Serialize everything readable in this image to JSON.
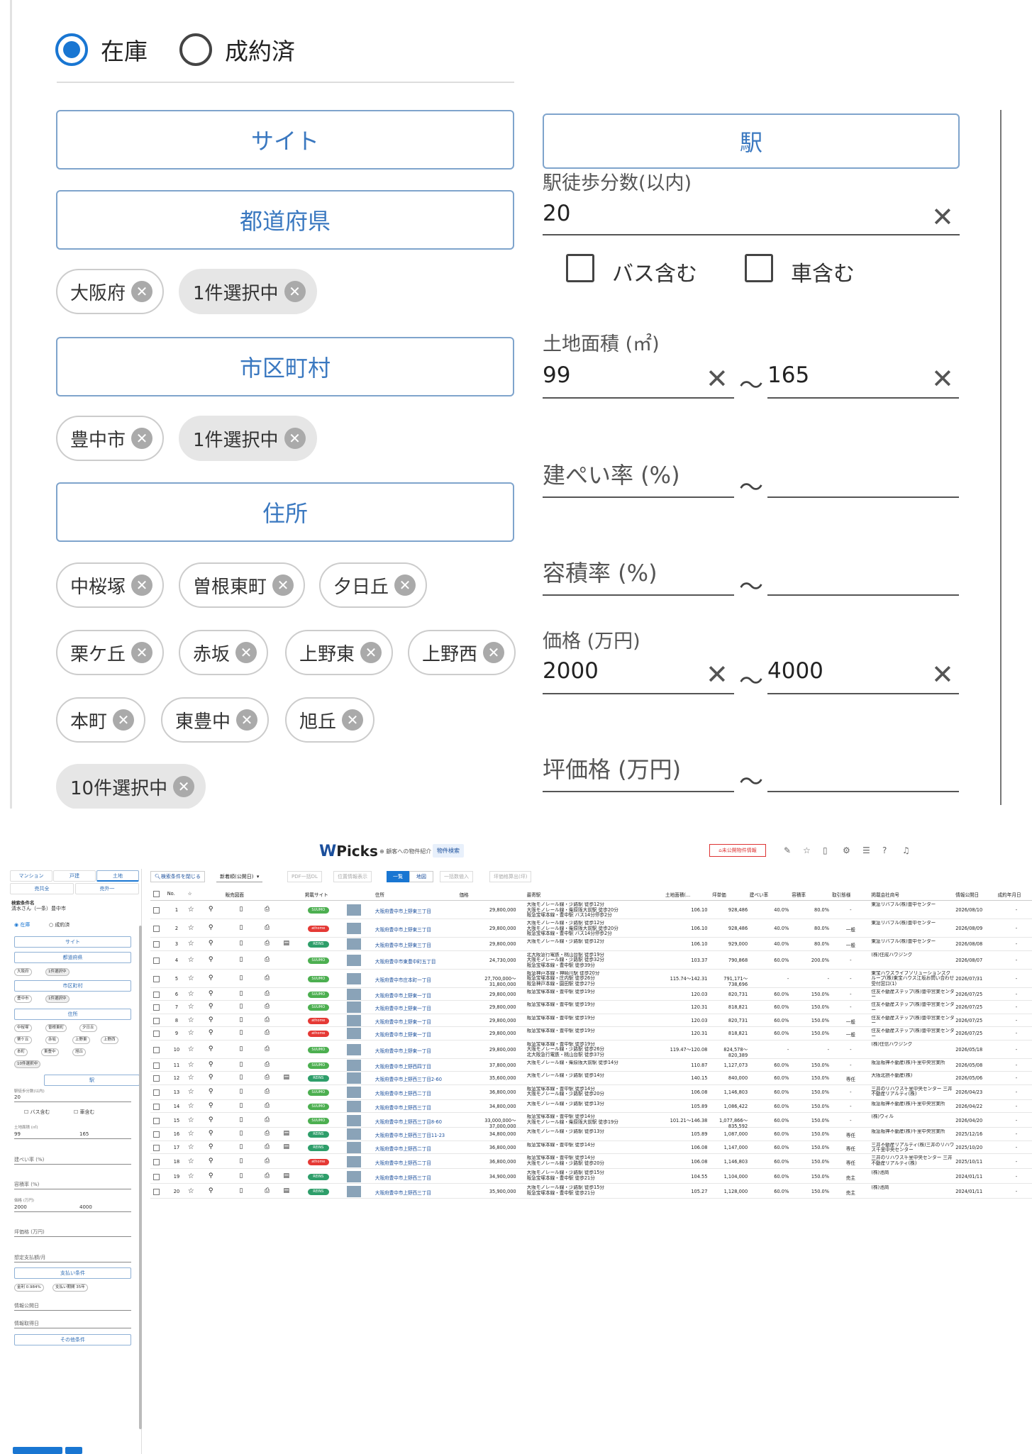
{
  "zoom": {
    "radio": {
      "stock": "在庫",
      "sold": "成約済"
    },
    "buttons": {
      "site": "サイト",
      "prefecture": "都道府県",
      "city": "市区町村",
      "address": "住所",
      "station": "駅"
    },
    "pref_chips": [
      "大阪府",
      "1件選択中"
    ],
    "city_chips": [
      "豊中市",
      "1件選択中"
    ],
    "address_chips": [
      "中桜塚",
      "曽根東町",
      "夕日丘",
      "栗ケ丘",
      "赤坂",
      "上野東",
      "上野西",
      "本町",
      "東豊中",
      "旭丘",
      "10件選択中"
    ],
    "walk": {
      "label": "駅徒歩分数(以内)",
      "value": "20"
    },
    "checks": {
      "bus": "バス含む",
      "car": "車含む"
    },
    "land": {
      "label": "土地面積 (㎡)",
      "min": "99",
      "max": "165"
    },
    "coverage": {
      "label": "建ぺい率 (%)"
    },
    "far": {
      "label": "容積率 (%)"
    },
    "price": {
      "label": "価格 (万円)",
      "min": "2000",
      "max": "4000"
    },
    "tsubo": {
      "label": "坪価格 (万円)"
    },
    "clear_glyph": "✕",
    "tilde": "～"
  },
  "app": {
    "logo_prefix": "W",
    "logo": "Picks",
    "nav_intro": "顧客への物件紹介",
    "nav_search": "物件検索",
    "unpublished_btn": "未公開物件情報",
    "sidebar": {
      "tabs": [
        "マンション",
        "戸建",
        "土地"
      ],
      "subtabs": [
        "売共全",
        "売外一"
      ],
      "cond_label": "検索条件名",
      "cond_value": "清水さん（一条）豊中市",
      "radio_stock": "在庫",
      "radio_sold": "成約済",
      "site": "サイト",
      "pref": "都道府県",
      "pref_chips": [
        "大阪府",
        "1件選択中"
      ],
      "city": "市区町村",
      "city_chips": [
        "豊中市",
        "1件選択中"
      ],
      "addr": "住所",
      "addr_chips_r1": [
        "中桜塚",
        "曽根東町",
        "夕日丘"
      ],
      "addr_chips_r2": [
        "栗ケ丘",
        "赤坂",
        "上野東",
        "上野西"
      ],
      "addr_chips_r3": [
        "本町",
        "東豊中",
        "旭丘"
      ],
      "addr_sel": "10件選択中",
      "station": "駅",
      "walk_label": "駅徒歩分数(以内)",
      "walk": "20",
      "bus": "バス含む",
      "car": "車含む",
      "land_label": "土地面積 (㎡)",
      "land_min": "99",
      "land_max": "165",
      "coverage": "建ぺい率 (%)",
      "far": "容積率 (%)",
      "price_label": "価格 (万円)",
      "price_min": "2000",
      "price_max": "4000",
      "tsubo": "坪価格 (万円)",
      "monthly": "想定支払額/月",
      "payment": "支払い条件",
      "pay_chips": [
        "金利 0.984%",
        "支払い期間 35年"
      ],
      "pub_date": "情報公開日",
      "get_date": "情報取得日",
      "other": "その他条件"
    },
    "toolbar": {
      "close_search": "検索条件を閉じる",
      "sort": "新着順(公開日)",
      "pdf": "PDF一括DL",
      "map_show": "位置情報表示",
      "list": "一覧",
      "map": "地図",
      "bulk": "一括数値入",
      "tsubo_calc": "坪価格算出(坪)"
    },
    "headers": [
      "No.",
      "☆",
      "",
      "販売図面",
      "",
      "",
      "掲載サイト",
      "",
      "住所",
      "価格",
      "最寄駅",
      "土地面積(...",
      "坪単価",
      "建ぺい率",
      "容積率",
      "取引態様",
      "掲載会社商号",
      "情報公開日",
      "成約年月日"
    ],
    "rows": [
      {
        "no": "1",
        "site": "SUUMO",
        "addr": "大阪府豊中市上野東三丁目",
        "price": "29,800,000",
        "station": "大阪モノレール線・少路駅 徒歩12分 / 大阪モノレール線・柴原阪大前駅 徒歩20分 / 阪急宝塚本線・豊中駅 バス14分停歩2分",
        "area": "106.10",
        "tsubo": "928,486",
        "cov": "40.0%",
        "far": "80.0%",
        "deal": "-",
        "company": "東急リバブル(株)豊中センター",
        "pub": "2026/08/10",
        "sold": "-"
      },
      {
        "no": "2",
        "site": "athome",
        "addr": "大阪府豊中市上野東三丁目",
        "price": "29,800,000",
        "station": "大阪モノレール線・少路駅 徒歩12分 / 大阪モノレール線・柴原阪大前駅 徒歩20分 / 阪急宝塚本線・豊中駅 バス14分停歩2分",
        "area": "106.10",
        "tsubo": "928,486",
        "cov": "40.0%",
        "far": "80.0%",
        "deal": "一般",
        "company": "東急リバブル(株)豊中センター",
        "pub": "2026/08/09",
        "sold": "-"
      },
      {
        "no": "3",
        "site": "REINS",
        "addr": "大阪府豊中市上野東三丁目",
        "price": "29,800,000",
        "station": "大阪モノレール線・少路駅 徒歩12分",
        "area": "106.10",
        "tsubo": "929,000",
        "cov": "40.0%",
        "far": "80.0%",
        "deal": "一般",
        "company": "東急リバブル(株)豊中センター",
        "pub": "2026/08/08",
        "sold": "-"
      },
      {
        "no": "4",
        "site": "SUUMO",
        "addr": "大阪府豊中市東豊中町五丁目",
        "price": "24,730,000",
        "station": "北大阪急行電鉄・桃山台駅 徒歩19分 / 大阪モノレール線・少路駅 徒歩32分 / 阪急宝塚本線・豊中駅 徒歩39分",
        "area": "103.37",
        "tsubo": "790,868",
        "cov": "60.0%",
        "far": "200.0%",
        "deal": "-",
        "company": "(株)住成ハウジング",
        "pub": "2026/08/07",
        "sold": "-"
      },
      {
        "no": "5",
        "site": "SUUMO",
        "addr": "大阪府豊中市庄本町一丁目",
        "price": "27,700,000～31,800,000",
        "station": "阪急神戸本線・神崎川駅 徒歩20分 / 阪急宝塚本線・庄内駅 徒歩26分 / 阪急神戸本線・園田駅 徒歩27分",
        "area": "115.74～142.31",
        "tsubo": "791,171～738,696",
        "cov": "-",
        "far": "-",
        "deal": "-",
        "company": "東宝ハウスライフソリューションズグループ(株)東宝ハウス江坂お問い合わせ受付窓口(1)",
        "pub": "2026/07/31",
        "sold": "-"
      },
      {
        "no": "6",
        "site": "SUUMO",
        "addr": "大阪府豊中市上野東一丁目",
        "price": "29,800,000",
        "station": "阪急宝塚本線・豊中駅 徒歩19分",
        "area": "120.03",
        "tsubo": "820,731",
        "cov": "60.0%",
        "far": "150.0%",
        "deal": "-",
        "company": "住友不動産ステップ(株)豊中営業センター",
        "pub": "2026/07/25",
        "sold": "-"
      },
      {
        "no": "7",
        "site": "SUUMO",
        "addr": "大阪府豊中市上野東一丁目",
        "price": "29,800,000",
        "station": "阪急宝塚本線・豊中駅 徒歩19分",
        "area": "120.31",
        "tsubo": "818,821",
        "cov": "60.0%",
        "far": "150.0%",
        "deal": "-",
        "company": "住友不動産ステップ(株)豊中営業センター",
        "pub": "2026/07/25",
        "sold": "-"
      },
      {
        "no": "8",
        "site": "athome",
        "addr": "大阪府豊中市上野東一丁目",
        "price": "29,800,000",
        "station": "阪急宝塚本線・豊中駅 徒歩19分",
        "area": "120.03",
        "tsubo": "820,731",
        "cov": "60.0%",
        "far": "150.0%",
        "deal": "一般",
        "company": "住友不動産ステップ(株)豊中営業センター",
        "pub": "2026/07/25",
        "sold": "-"
      },
      {
        "no": "9",
        "site": "athome",
        "addr": "大阪府豊中市上野東一丁目",
        "price": "29,800,000",
        "station": "阪急宝塚本線・豊中駅 徒歩19分",
        "area": "120.31",
        "tsubo": "818,821",
        "cov": "60.0%",
        "far": "150.0%",
        "deal": "一般",
        "company": "住友不動産ステップ(株)豊中営業センター",
        "pub": "2026/07/25",
        "sold": "-"
      },
      {
        "no": "10",
        "site": "SUUMO",
        "addr": "大阪府豊中市上野東一丁目",
        "price": "29,800,000",
        "station": "阪急宝塚本線・豊中駅 徒歩19分 / 大阪モノレール線・少路駅 徒歩26分 / 北大阪急行電鉄・桃山台駅 徒歩37分",
        "area": "119.47～120.08",
        "tsubo": "824,578～820,389",
        "cov": "-",
        "far": "-",
        "deal": "-",
        "company": "(株)住信ハウジング",
        "pub": "2026/05/18",
        "sold": "-"
      },
      {
        "no": "11",
        "site": "SUUMO",
        "addr": "大阪府豊中市上野西四丁目",
        "price": "37,800,000",
        "station": "大阪モノレール線・柴原阪大前駅 徒歩14分",
        "area": "110.87",
        "tsubo": "1,127,073",
        "cov": "60.0%",
        "far": "150.0%",
        "deal": "-",
        "company": "阪急阪神不動産(株)千里中央営業所",
        "pub": "2026/05/08",
        "sold": "-"
      },
      {
        "no": "12",
        "site": "REINS",
        "addr": "大阪府豊中市上野西三丁目2-60",
        "price": "35,600,000",
        "station": "大阪モノレール線・少路駅 徒歩14分",
        "area": "140.15",
        "tsubo": "840,000",
        "cov": "60.0%",
        "far": "150.0%",
        "deal": "専任",
        "company": "大阪北摂不動産(株)",
        "pub": "2026/05/06",
        "sold": "-"
      },
      {
        "no": "13",
        "site": "SUUMO",
        "addr": "大阪府豊中市上野西二丁目",
        "price": "36,800,000",
        "station": "阪急宝塚本線・豊中駅 徒歩14分 / 大阪モノレール線・少路駅 徒歩20分",
        "area": "106.08",
        "tsubo": "1,146,803",
        "cov": "60.0%",
        "far": "150.0%",
        "deal": "-",
        "company": "三井のリハウス千里中央センター 三井不動産リアルティ(株)",
        "pub": "2026/04/23",
        "sold": "-"
      },
      {
        "no": "14",
        "site": "SUUMO",
        "addr": "大阪府豊中市上野西三丁目",
        "price": "34,800,000",
        "station": "大阪モノレール線・少路駅 徒歩13分",
        "area": "105.89",
        "tsubo": "1,086,422",
        "cov": "60.0%",
        "far": "150.0%",
        "deal": "-",
        "company": "阪急阪神不動産(株)千里中央営業所",
        "pub": "2026/04/22",
        "sold": "-"
      },
      {
        "no": "15",
        "site": "SUUMO",
        "addr": "大阪府豊中市上野西三丁目8-60",
        "price": "33,000,000～37,000,000",
        "station": "阪急宝塚本線・豊中駅 徒歩14分 / 大阪モノレール線・柴原阪大前駅 徒歩19分",
        "area": "101.21～146.38",
        "tsubo": "1,077,866～835,592",
        "cov": "60.0%",
        "far": "150.0%",
        "deal": "-",
        "company": "(株)ウィル",
        "pub": "2026/04/20",
        "sold": "-"
      },
      {
        "no": "16",
        "site": "REINS",
        "addr": "大阪府豊中市上野西三丁目11-23",
        "price": "34,800,000",
        "station": "大阪モノレール線・少路駅 徒歩13分",
        "area": "105.89",
        "tsubo": "1,087,000",
        "cov": "60.0%",
        "far": "150.0%",
        "deal": "専任",
        "company": "阪急阪神不動産(株)千里中央営業所",
        "pub": "2025/12/16",
        "sold": "-"
      },
      {
        "no": "17",
        "site": "REINS",
        "addr": "大阪府豊中市上野西二丁目",
        "price": "36,800,000",
        "station": "阪急宝塚本線・豊中駅 徒歩14分",
        "area": "106.08",
        "tsubo": "1,147,000",
        "cov": "60.0%",
        "far": "150.0%",
        "deal": "専任",
        "company": "三井不動産リアルティ(株)三井のリハウス千里中央センター",
        "pub": "2025/10/20",
        "sold": "-"
      },
      {
        "no": "18",
        "site": "athome",
        "addr": "大阪府豊中市上野西二丁目",
        "price": "36,800,000",
        "station": "阪急宝塚本線・豊中駅 徒歩14分 / 大阪モノレール線・少路駅 徒歩20分",
        "area": "106.08",
        "tsubo": "1,146,803",
        "cov": "60.0%",
        "far": "150.0%",
        "deal": "専任",
        "company": "三井のリハウス千里中央センター 三井不動産リアルティ(株)",
        "pub": "2025/10/11",
        "sold": "-"
      },
      {
        "no": "19",
        "site": "REINS",
        "addr": "大阪府豊中市上野西三丁目",
        "price": "34,900,000",
        "station": "大阪モノレール線・少路駅 徒歩15分 / 阪急宝塚本線・豊中駅 徒歩21分",
        "area": "104.55",
        "tsubo": "1,104,000",
        "cov": "60.0%",
        "far": "150.0%",
        "deal": "売主",
        "company": "(株)池商",
        "pub": "2024/01/11",
        "sold": "-"
      },
      {
        "no": "20",
        "site": "REINS",
        "addr": "大阪府豊中市上野西三丁目",
        "price": "35,900,000",
        "station": "大阪モノレール線・少路駅 徒歩15分 / 阪急宝塚本線・豊中駅 徒歩21分",
        "area": "105.27",
        "tsubo": "1,128,000",
        "cov": "60.0%",
        "far": "150.0%",
        "deal": "売主",
        "company": "(株)池商",
        "pub": "2024/01/11",
        "sold": "-"
      }
    ],
    "colors": {
      "suumo": "#4caf50",
      "athome": "#e53935",
      "reins": "#2e9e6a",
      "accent": "#1976d2"
    }
  }
}
